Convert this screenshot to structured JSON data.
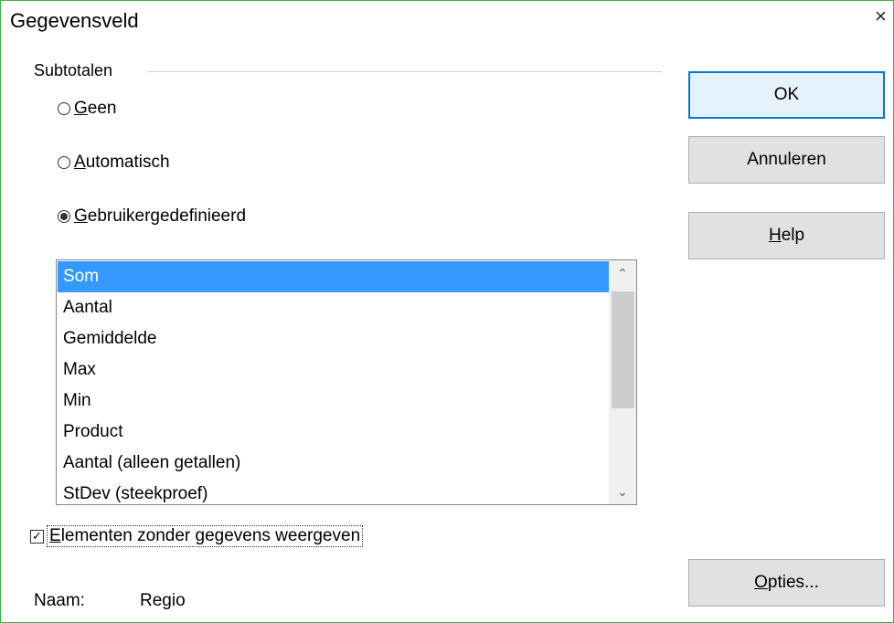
{
  "window": {
    "title": "Gegevensveld",
    "close_symbol": "×"
  },
  "subtotals": {
    "group_label": "Subtotalen",
    "options": [
      {
        "accel": "G",
        "rest": "een",
        "selected": false
      },
      {
        "accel": "A",
        "rest": "utomatisch",
        "selected": false
      },
      {
        "accel": "G",
        "rest": "ebruikergedefinieerd",
        "selected": true
      }
    ],
    "functions": [
      "Som",
      "Aantal",
      "Gemiddelde",
      "Max",
      "Min",
      "Product",
      "Aantal (alleen getallen)",
      "StDev (steekproef)"
    ],
    "selected_function": "Som",
    "scroll_up_symbol": "⌃",
    "scroll_down_symbol": "⌄"
  },
  "show_empty": {
    "checked": true,
    "check_symbol": "✓",
    "accel": "E",
    "rest": "lementen zonder gegevens weergeven"
  },
  "name": {
    "label": "Naam:",
    "value": "Regio"
  },
  "buttons": {
    "ok": "OK",
    "cancel": "Annuleren",
    "help_accel": "H",
    "help_rest": "elp",
    "options_accel": "O",
    "options_rest": "pties..."
  }
}
